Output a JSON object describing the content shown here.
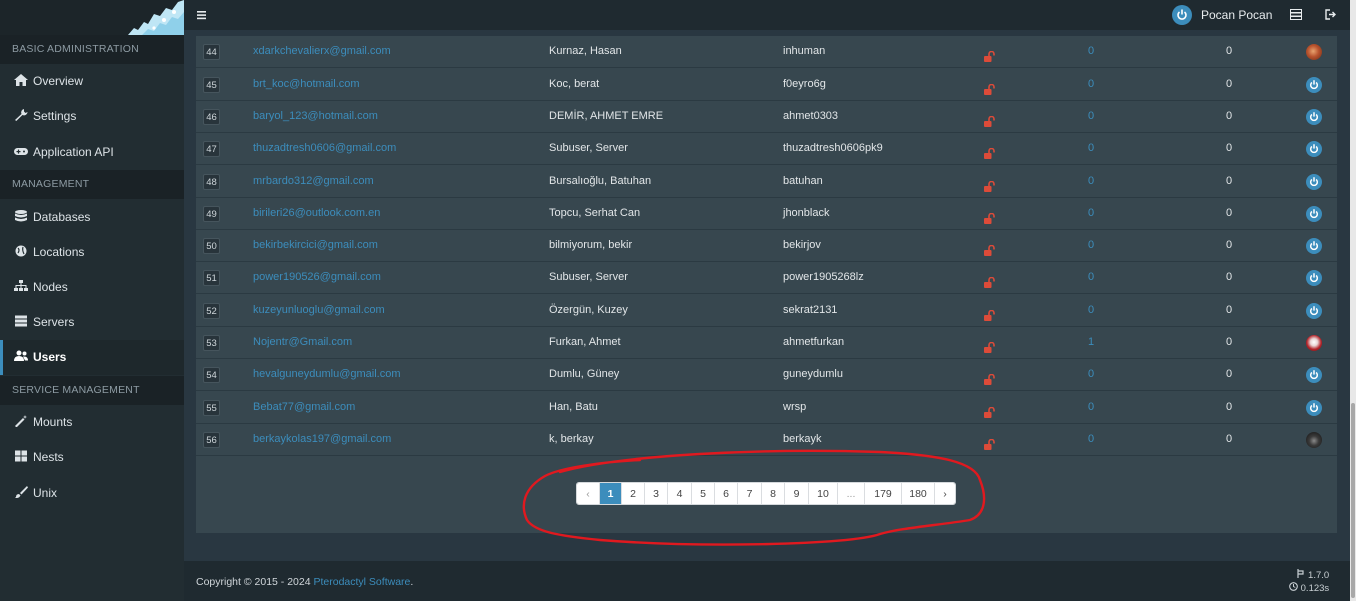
{
  "sidebar": {
    "sections": [
      {
        "title": "BASIC ADMINISTRATION"
      },
      {
        "title": "MANAGEMENT"
      },
      {
        "title": "SERVICE MANAGEMENT"
      }
    ],
    "items": [
      {
        "label": "Overview",
        "icon": "home-icon"
      },
      {
        "label": "Settings",
        "icon": "wrench-icon"
      },
      {
        "label": "Application API",
        "icon": "gamepad-icon"
      },
      {
        "label": "Databases",
        "icon": "database-icon"
      },
      {
        "label": "Locations",
        "icon": "globe-icon"
      },
      {
        "label": "Nodes",
        "icon": "sitemap-icon"
      },
      {
        "label": "Servers",
        "icon": "server-icon"
      },
      {
        "label": "Users",
        "icon": "users-icon",
        "active": true
      },
      {
        "label": "Mounts",
        "icon": "magic-icon"
      },
      {
        "label": "Nests",
        "icon": "th-large-icon"
      },
      {
        "label": "Unix",
        "icon": "paint-brush-icon"
      }
    ]
  },
  "topbar": {
    "user_name": "Pocan Pocan"
  },
  "users": [
    {
      "id": "44",
      "email": "xdarkchevalierx@gmail.com",
      "name": "Kurnaz, Hasan",
      "username": "inhuman",
      "servers": "0",
      "subusers": "0",
      "avatar": "photo-orange"
    },
    {
      "id": "45",
      "email": "brt_koc@hotmail.com",
      "name": "Koc, berat",
      "username": "f0eyro6g",
      "servers": "0",
      "subusers": "0",
      "avatar": "power"
    },
    {
      "id": "46",
      "email": "baryol_123@hotmail.com",
      "name": "DEMİR, AHMET EMRE",
      "username": "ahmet0303",
      "servers": "0",
      "subusers": "0",
      "avatar": "power"
    },
    {
      "id": "47",
      "email": "thuzadtresh0606@gmail.com",
      "name": "Subuser, Server",
      "username": "thuzadtresh0606pk9",
      "servers": "0",
      "subusers": "0",
      "avatar": "power"
    },
    {
      "id": "48",
      "email": "mrbardo312@gmail.com",
      "name": "Bursalıoğlu, Batuhan",
      "username": "batuhan",
      "servers": "0",
      "subusers": "0",
      "avatar": "power"
    },
    {
      "id": "49",
      "email": "birileri26@outlook.com.en",
      "name": "Topcu, Serhat Can",
      "username": "jhonblack",
      "servers": "0",
      "subusers": "0",
      "avatar": "power"
    },
    {
      "id": "50",
      "email": "bekirbekircici@gmail.com",
      "name": "bilmiyorum, bekir",
      "username": "bekirjov",
      "servers": "0",
      "subusers": "0",
      "avatar": "power"
    },
    {
      "id": "51",
      "email": "power190526@gmail.com",
      "name": "Subuser, Server",
      "username": "power1905268lz",
      "servers": "0",
      "subusers": "0",
      "avatar": "power"
    },
    {
      "id": "52",
      "email": "kuzeyunluoglu@gmail.com",
      "name": "Özergün, Kuzey",
      "username": "sekrat2131",
      "servers": "0",
      "subusers": "0",
      "avatar": "power"
    },
    {
      "id": "53",
      "email": "Nojentr@Gmail.com",
      "name": "Furkan, Ahmet",
      "username": "ahmetfurkan",
      "servers": "1",
      "subusers": "0",
      "avatar": "photo-red"
    },
    {
      "id": "54",
      "email": "hevalguneydumlu@gmail.com",
      "name": "Dumlu, Güney",
      "username": "guneydumlu",
      "servers": "0",
      "subusers": "0",
      "avatar": "power"
    },
    {
      "id": "55",
      "email": "Bebat77@gmail.com",
      "name": "Han, Batu",
      "username": "wrsp",
      "servers": "0",
      "subusers": "0",
      "avatar": "power"
    },
    {
      "id": "56",
      "email": "berkaykolas197@gmail.com",
      "name": "k, berkay",
      "username": "berkayk",
      "servers": "0",
      "subusers": "0",
      "avatar": "photo-dark"
    }
  ],
  "pagination": {
    "prev": "‹",
    "next": "›",
    "pages": [
      "1",
      "2",
      "3",
      "4",
      "5",
      "6",
      "7",
      "8",
      "9",
      "10",
      "...",
      "179",
      "180"
    ],
    "active": "1"
  },
  "footer": {
    "copyright": "Copyright © 2015 - 2024 ",
    "brand": "Pterodactyl Software",
    "period": ".",
    "version": "1.7.0",
    "time": "0.123s"
  },
  "colors": {
    "accent": "#3c8dbc",
    "lock": "#dd4b39",
    "annotation": "#e0191f"
  }
}
